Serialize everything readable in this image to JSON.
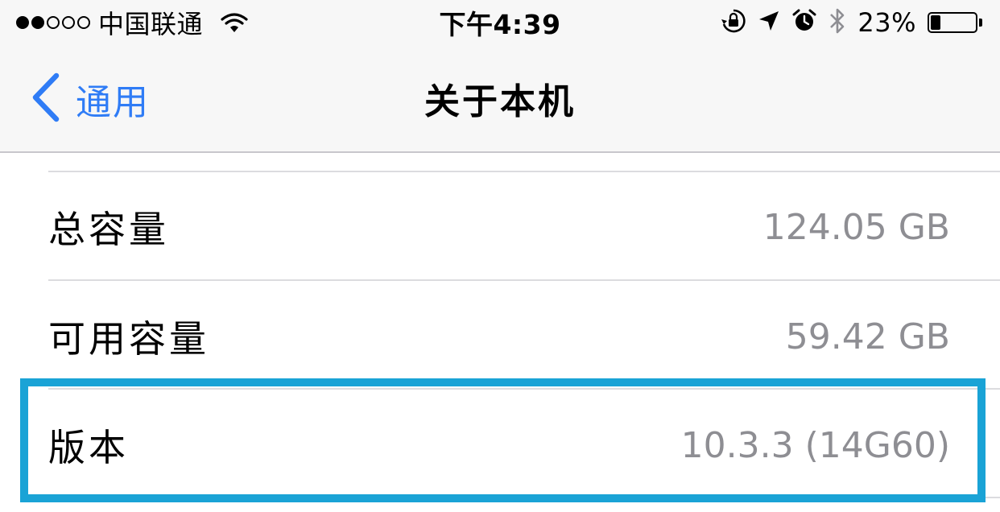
{
  "status_bar": {
    "carrier": "中国联通",
    "signal_bars_filled": 2,
    "signal_bars_total": 5,
    "time": "下午4:39",
    "battery_percent_text": "23%",
    "battery_level": 0.23,
    "icons": [
      "wifi-icon",
      "orientation-lock-icon",
      "location-arrow-icon",
      "alarm-clock-icon",
      "bluetooth-icon",
      "battery-icon"
    ]
  },
  "nav": {
    "back_label": "通用",
    "title": "关于本机",
    "accent_color": "#2f7cf6"
  },
  "rows": [
    {
      "label": "总容量",
      "value": "124.05 GB"
    },
    {
      "label": "可用容量",
      "value": "59.42 GB"
    },
    {
      "label": "版本",
      "value": "10.3.3 (14G60)"
    }
  ],
  "colors": {
    "value_text": "#8e8e93",
    "highlight_border": "#1aa3d6",
    "bar_background": "#f7f7f7"
  }
}
